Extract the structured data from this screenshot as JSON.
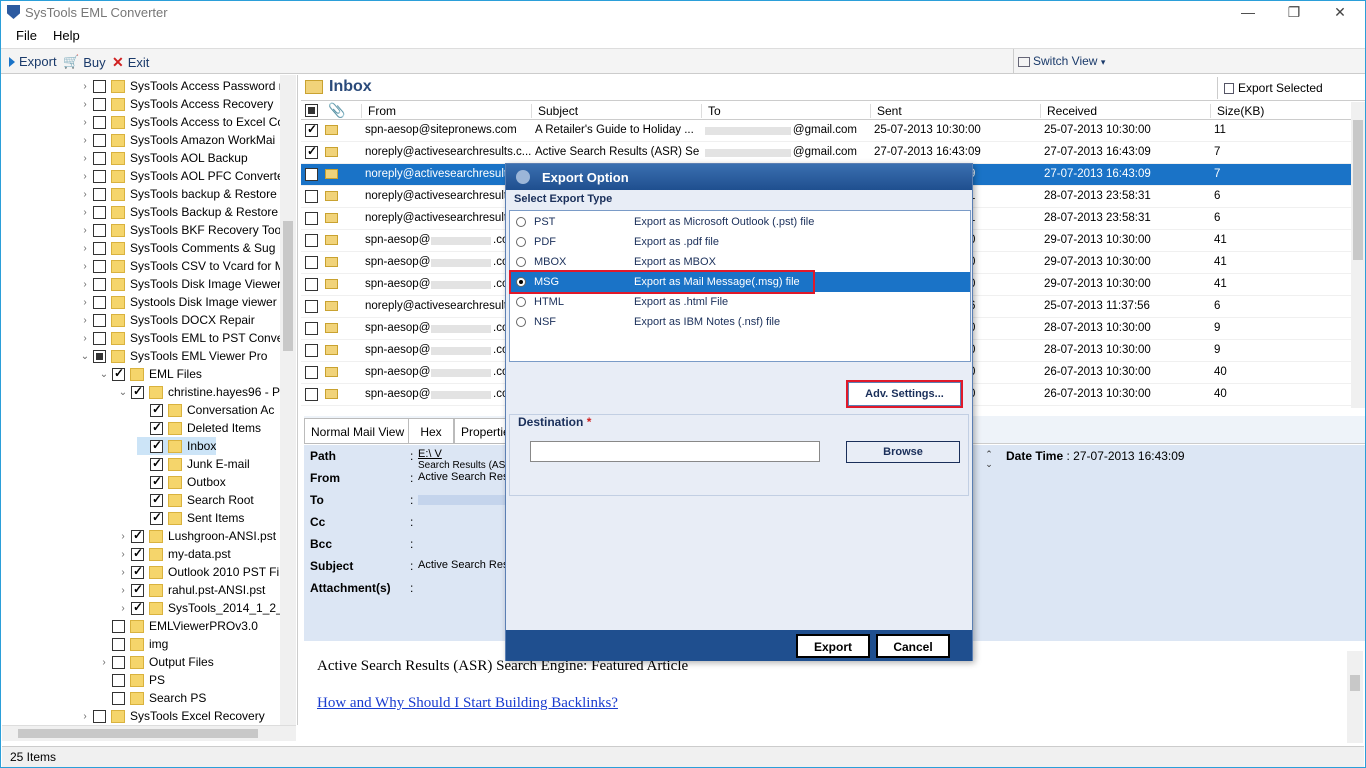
{
  "window": {
    "title": "SysTools EML Converter",
    "minimize": "—",
    "maximize": "❐",
    "close": "✕"
  },
  "menu": {
    "file": "File",
    "help": "Help"
  },
  "toolbar": {
    "export": "Export",
    "buy": "Buy",
    "exit": "Exit",
    "switch_view": "Switch View"
  },
  "tree": [
    {
      "label": "SysTools Access Password r",
      "indent": 0,
      "check": "off",
      "twisty": "›"
    },
    {
      "label": "SysTools Access Recovery",
      "indent": 0,
      "check": "off",
      "twisty": "›"
    },
    {
      "label": "SysTools Access to Excel Co",
      "indent": 0,
      "check": "off",
      "twisty": "›"
    },
    {
      "label": "SysTools Amazon WorkMai",
      "indent": 0,
      "check": "off",
      "twisty": "›"
    },
    {
      "label": "SysTools AOL Backup",
      "indent": 0,
      "check": "off",
      "twisty": "›"
    },
    {
      "label": "SysTools AOL PFC Converte",
      "indent": 0,
      "check": "off",
      "twisty": "›"
    },
    {
      "label": "SysTools backup & Restore",
      "indent": 0,
      "check": "off",
      "twisty": "›"
    },
    {
      "label": "SysTools Backup & Restore",
      "indent": 0,
      "check": "off",
      "twisty": "›"
    },
    {
      "label": "SysTools BKF Recovery Tool",
      "indent": 0,
      "check": "off",
      "twisty": "›"
    },
    {
      "label": "SysTools Comments & Sug",
      "indent": 0,
      "check": "off",
      "twisty": "›"
    },
    {
      "label": "SysTools CSV to Vcard for M",
      "indent": 0,
      "check": "off",
      "twisty": "›"
    },
    {
      "label": "SysTools Disk Image Viewer",
      "indent": 0,
      "check": "off",
      "twisty": "›"
    },
    {
      "label": "Systools Disk Image viewer",
      "indent": 0,
      "check": "off",
      "twisty": "›"
    },
    {
      "label": "SysTools DOCX Repair",
      "indent": 0,
      "check": "off",
      "twisty": "›"
    },
    {
      "label": "SysTools EML to PST Conve",
      "indent": 0,
      "check": "off",
      "twisty": "›"
    },
    {
      "label": "SysTools EML Viewer Pro",
      "indent": 0,
      "check": "part",
      "twisty": "⌄"
    },
    {
      "label": "EML Files",
      "indent": 1,
      "check": "on",
      "twisty": "⌄"
    },
    {
      "label": "christine.hayes96 - P",
      "indent": 2,
      "check": "on",
      "twisty": "⌄"
    },
    {
      "label": "Conversation Ac",
      "indent": 3,
      "check": "on",
      "twisty": ""
    },
    {
      "label": "Deleted Items",
      "indent": 3,
      "check": "on",
      "twisty": ""
    },
    {
      "label": "Inbox",
      "indent": 3,
      "check": "on",
      "twisty": "",
      "selected": true
    },
    {
      "label": "Junk E-mail",
      "indent": 3,
      "check": "on",
      "twisty": ""
    },
    {
      "label": "Outbox",
      "indent": 3,
      "check": "on",
      "twisty": ""
    },
    {
      "label": "Search Root",
      "indent": 3,
      "check": "on",
      "twisty": ""
    },
    {
      "label": "Sent Items",
      "indent": 3,
      "check": "on",
      "twisty": ""
    },
    {
      "label": "Lushgroon-ANSI.pst",
      "indent": 2,
      "check": "on",
      "twisty": "›"
    },
    {
      "label": "my-data.pst",
      "indent": 2,
      "check": "on",
      "twisty": "›"
    },
    {
      "label": "Outlook 2010 PST Fi",
      "indent": 2,
      "check": "on",
      "twisty": "›"
    },
    {
      "label": "rahul.pst-ANSI.pst",
      "indent": 2,
      "check": "on",
      "twisty": "›"
    },
    {
      "label": "SysTools_2014_1_2_1",
      "indent": 2,
      "check": "on",
      "twisty": "›"
    },
    {
      "label": "EMLViewerPROv3.0",
      "indent": 1,
      "check": "off",
      "twisty": ""
    },
    {
      "label": "img",
      "indent": 1,
      "check": "off",
      "twisty": ""
    },
    {
      "label": "Output Files",
      "indent": 1,
      "check": "off",
      "twisty": "›"
    },
    {
      "label": "PS",
      "indent": 1,
      "check": "off",
      "twisty": ""
    },
    {
      "label": "Search PS",
      "indent": 1,
      "check": "off",
      "twisty": ""
    },
    {
      "label": "SysTools Excel Recovery",
      "indent": 0,
      "check": "off",
      "twisty": "›"
    }
  ],
  "status": {
    "items": "25 Items"
  },
  "inbox": {
    "title": "Inbox",
    "export_selected": "Export Selected",
    "columns": {
      "from": "From",
      "subject": "Subject",
      "to": "To",
      "sent": "Sent",
      "received": "Received",
      "size": "Size(KB)"
    },
    "rows": [
      {
        "from": "spn-aesop@sitepronews.com",
        "subject": "A Retailer's Guide to Holiday ...",
        "to": "@gmail.com",
        "sent": "25-07-2013 10:30:00",
        "received": "25-07-2013 10:30:00",
        "size": "11",
        "checked": true
      },
      {
        "from": "noreply@activesearchresults.c...",
        "subject": "Active Search Results (ASR) Se...",
        "to": "@gmail.com",
        "sent": "27-07-2013 16:43:09",
        "received": "27-07-2013 16:43:09",
        "size": "7",
        "checked": true
      },
      {
        "from": "noreply@activesearchresult",
        "subject": "",
        "to": "",
        "sent": "9",
        "received": "27-07-2013 16:43:09",
        "size": "7",
        "checked": true,
        "selected": true
      },
      {
        "from": "noreply@activesearchresult",
        "subject": "",
        "to": "",
        "sent": "1",
        "received": "28-07-2013 23:58:31",
        "size": "6",
        "checked": false
      },
      {
        "from": "noreply@activesearchresult",
        "subject": "",
        "to": "",
        "sent": "1",
        "received": "28-07-2013 23:58:31",
        "size": "6",
        "checked": false
      },
      {
        "from": "spn-aesop@",
        "subject": "",
        "to": "",
        "sent": "0",
        "received": "29-07-2013 10:30:00",
        "size": "41",
        "checked": false,
        "suffix": ".co"
      },
      {
        "from": "spn-aesop@",
        "subject": "",
        "to": "",
        "sent": "0",
        "received": "29-07-2013 10:30:00",
        "size": "41",
        "checked": false,
        "suffix": ".co"
      },
      {
        "from": "spn-aesop@",
        "subject": "",
        "to": "",
        "sent": "0",
        "received": "29-07-2013 10:30:00",
        "size": "41",
        "checked": false,
        "suffix": ".co"
      },
      {
        "from": "noreply@activesearchresult",
        "subject": "",
        "to": "",
        "sent": "6",
        "received": "25-07-2013 11:37:56",
        "size": "6",
        "checked": false
      },
      {
        "from": "spn-aesop@",
        "subject": "",
        "to": "",
        "sent": "0",
        "received": "28-07-2013 10:30:00",
        "size": "9",
        "checked": false,
        "suffix": ".co"
      },
      {
        "from": "spn-aesop@",
        "subject": "",
        "to": "",
        "sent": "0",
        "received": "28-07-2013 10:30:00",
        "size": "9",
        "checked": false,
        "suffix": ".co"
      },
      {
        "from": "spn-aesop@",
        "subject": "",
        "to": "",
        "sent": "0",
        "received": "26-07-2013 10:30:00",
        "size": "40",
        "checked": false,
        "suffix": ".co"
      },
      {
        "from": "spn-aesop@",
        "subject": "",
        "to": "",
        "sent": "0",
        "received": "26-07-2013 10:30:00",
        "size": "40",
        "checked": false,
        "suffix": ".co"
      }
    ]
  },
  "preview": {
    "tabs": [
      "Normal Mail View",
      "Hex",
      "Properties"
    ],
    "labels": {
      "path": "Path",
      "from": "From",
      "to": "To",
      "cc": "Cc",
      "bcc": "Bcc",
      "subject": "Subject",
      "attachments": "Attachment(s)"
    },
    "path_value": "E:\\ V",
    "path_sub": "Search Results (AS",
    "from_value": "Active Search Res",
    "subject_value": "Active Search Res",
    "colon": ":",
    "date_label": "Date Time",
    "date_value": "27-07-2013 16:43:09",
    "body_heading": "Active Search Results (ASR) Search Engine: Featured Article",
    "body_link": "How and Why Should I Start Building Backlinks?"
  },
  "dialog": {
    "title": "Export Option",
    "select_label": "Select Export Type",
    "options": [
      {
        "name": "PST",
        "desc": "Export as Microsoft Outlook (.pst) file",
        "selected": false
      },
      {
        "name": "PDF",
        "desc": "Export as .pdf file",
        "selected": false
      },
      {
        "name": "MBOX",
        "desc": "Export as MBOX",
        "selected": false
      },
      {
        "name": "MSG",
        "desc": "Export as Mail Message(.msg) file",
        "selected": true
      },
      {
        "name": "HTML",
        "desc": "Export as .html File",
        "selected": false
      },
      {
        "name": "NSF",
        "desc": "Export as IBM Notes (.nsf) file",
        "selected": false
      }
    ],
    "adv_settings": "Adv. Settings...",
    "destination_label": "Destination",
    "required_mark": "*",
    "destination_value": "",
    "browse": "Browse",
    "export": "Export",
    "cancel": "Cancel"
  },
  "colors": {
    "accent": "#1a73c7",
    "highlight_red": "#e0192a",
    "dialog_header": "#1f4f8f"
  }
}
